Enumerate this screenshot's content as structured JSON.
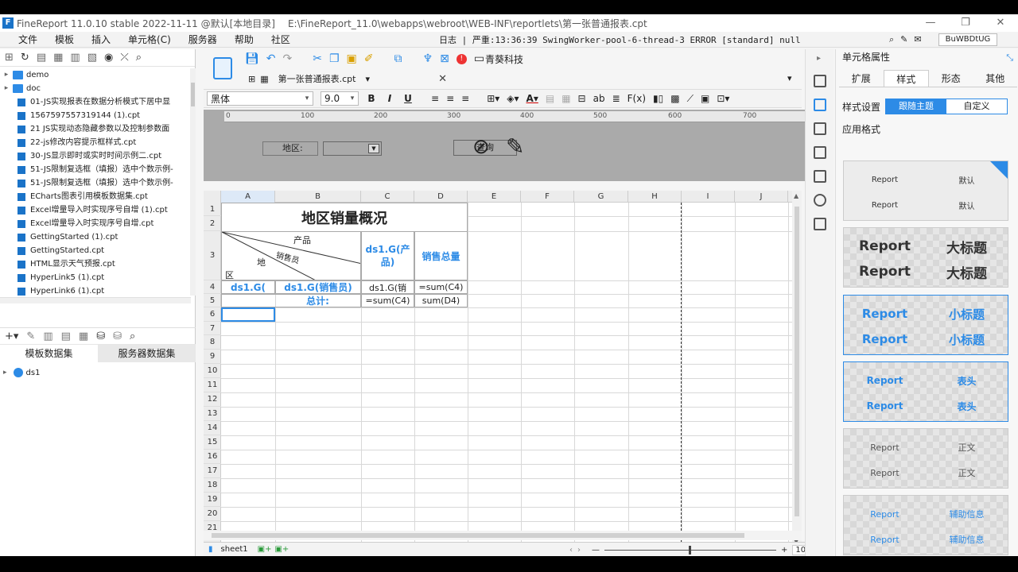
{
  "window": {
    "title": "FineReport 11.0.10 stable 2022-11-11 @默认[本地目录]",
    "path": "E:\\FineReport_11.0\\webapps\\webroot\\WEB-INF\\reportlets\\第一张普通报表.cpt",
    "min": "—",
    "max": "❐",
    "close": "✕"
  },
  "menu": [
    "文件",
    "模板",
    "插入",
    "单元格(C)",
    "服务器",
    "帮助",
    "社区"
  ],
  "log": "日志 | 严重:13:36:39 SwingWorker-pool-6-thread-3 ERROR [standard] null",
  "user": "BuWBDtUG",
  "tree": [
    {
      "label": "demo",
      "type": "folder"
    },
    {
      "label": "doc",
      "type": "folder"
    },
    {
      "label": "01-JS实现报表在数据分析模式下居中显",
      "type": "file"
    },
    {
      "label": "1567597557319144 (1).cpt",
      "type": "file"
    },
    {
      "label": "21 JS实现动态隐藏参数以及控制参数面",
      "type": "file"
    },
    {
      "label": "22-js修改内容提示框样式.cpt",
      "type": "file"
    },
    {
      "label": "30-JS显示即时或实时时间示例二.cpt",
      "type": "file"
    },
    {
      "label": "51-JS限制复选框（填报）选中个数示例-",
      "type": "file"
    },
    {
      "label": "51-JS限制复选框（填报）选中个数示例-",
      "type": "file"
    },
    {
      "label": "ECharts图表引用模板数据集.cpt",
      "type": "file"
    },
    {
      "label": "Excel增量导入时实现序号自增 (1).cpt",
      "type": "file"
    },
    {
      "label": "Excel增量导入时实现序号自增.cpt",
      "type": "file"
    },
    {
      "label": "GettingStarted (1).cpt",
      "type": "file"
    },
    {
      "label": "GettingStarted.cpt",
      "type": "file"
    },
    {
      "label": "HTML显示天气预报.cpt",
      "type": "file"
    },
    {
      "label": "HyperLink5 (1).cpt",
      "type": "file"
    },
    {
      "label": "HyperLink6 (1).cpt",
      "type": "file"
    }
  ],
  "dataset_tabs": [
    "模板数据集",
    "服务器数据集"
  ],
  "dataset_item": "ds1",
  "toolbar": {
    "brand": "青葵科技"
  },
  "doc_tab": "第一张普通报表.cpt",
  "font": {
    "family": "黑体",
    "size": "9.0"
  },
  "ruler": [
    "0",
    "100",
    "200",
    "300",
    "400",
    "500",
    "600",
    "700"
  ],
  "param": {
    "label": "地区:",
    "button": "查询"
  },
  "columns": [
    "A",
    "B",
    "C",
    "D",
    "E",
    "F",
    "G",
    "H",
    "I",
    "J"
  ],
  "rows": [
    "1",
    "2",
    "3",
    "4",
    "5",
    "6",
    "7",
    "8",
    "9",
    "10",
    "11",
    "12",
    "13",
    "14",
    "15",
    "16",
    "17",
    "18",
    "19",
    "20",
    "21"
  ],
  "cells": {
    "title": "地区销量概况",
    "diag_product": "产品",
    "diag_sales": "销售员",
    "diag_region1": "地",
    "diag_region2": "区",
    "c3": "ds1.G(产品)",
    "d3": "销售总量",
    "a4": "ds1.G(",
    "b4": "ds1.G(销售员)",
    "c4": "ds1.G(销",
    "d4": "=sum(C4)",
    "b5": "总计:",
    "c5": "=sum(C4)",
    "d5": "sum(D4)"
  },
  "sheet": "sheet1",
  "zoom": "100",
  "zoom_unit": "%",
  "right": {
    "title": "单元格属性",
    "tabs": [
      "扩展",
      "样式",
      "形态",
      "其他"
    ],
    "style_label": "样式设置",
    "seg": [
      "跟随主题",
      "自定义"
    ],
    "apply": "应用格式",
    "styles": [
      {
        "left": "Report",
        "right": "默认",
        "color": "#333333"
      },
      {
        "left": "Report",
        "right": "大标题",
        "color": "#333333"
      },
      {
        "left": "Report",
        "right": "小标题",
        "color": "#2d8be6"
      },
      {
        "left": "Report",
        "right": "表头",
        "color": "#2d8be6"
      },
      {
        "left": "Report",
        "right": "正文",
        "color": "#555555"
      },
      {
        "left": "Report",
        "right": "辅助信息",
        "color": "#2d8be6"
      }
    ]
  }
}
